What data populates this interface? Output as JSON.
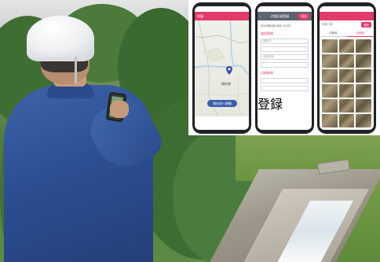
{
  "phones": {
    "map_screen": {
      "header_label": "地図",
      "place_label": "現在地",
      "action_button": "現在地へ移動"
    },
    "form_screen": {
      "header_title": "点検記録登録",
      "save_label": "保存",
      "date": "2022年4月18日 13:25",
      "section_location": "施設情報",
      "field_1": "施設名",
      "field_2": "",
      "field_3": "点検日時",
      "field_4": "",
      "section_result": "点検結果",
      "field_5": "",
      "field_6": "",
      "submit_label": "登録"
    },
    "gallery_screen": {
      "header_left": "写真一覧",
      "header_button": "選択",
      "tab_1": "点検前",
      "tab_2": "点検後"
    }
  },
  "colors": {
    "accent": "#e33a6a",
    "jacket": "#2c4f93",
    "phone_frame": "#1f2226"
  }
}
